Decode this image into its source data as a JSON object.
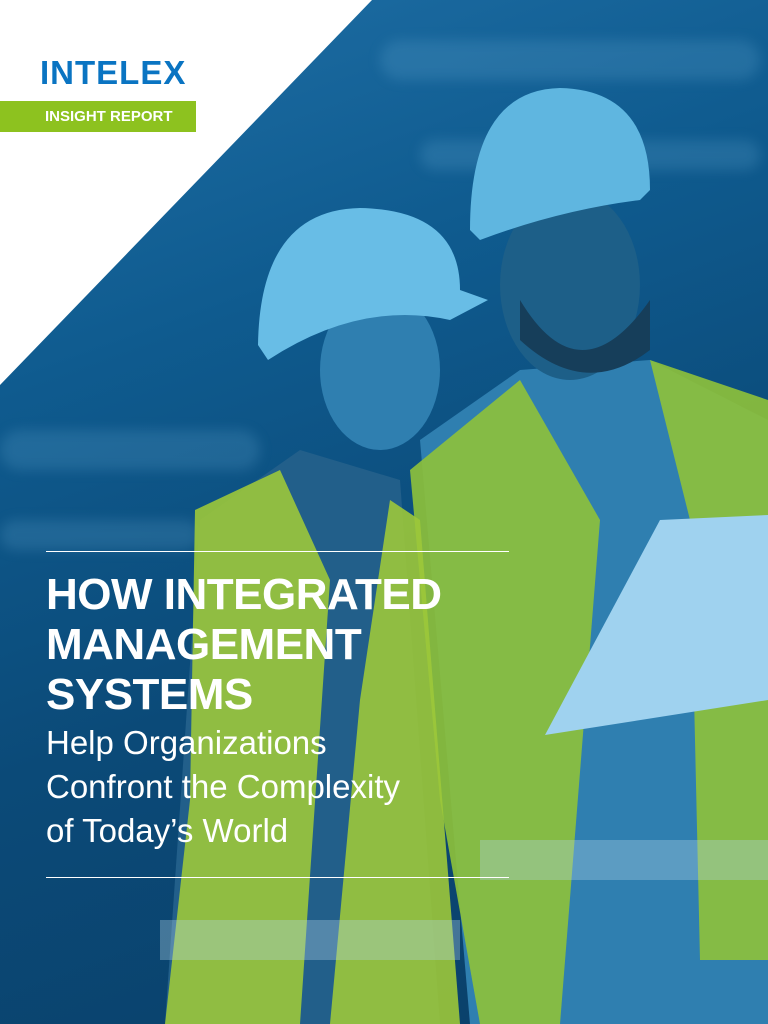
{
  "brand": {
    "logo_text": "INTELEX",
    "badge": "INSIGHT REPORT",
    "accent": "#8dc21f",
    "logo_color": "#0a74c2"
  },
  "cover": {
    "title_lines": [
      "HOW INTEGRATED",
      "MANAGEMENT",
      "SYSTEMS"
    ],
    "subtitle_lines": [
      "Help Organizations",
      "Confront the Complexity",
      "of Today’s World"
    ]
  }
}
